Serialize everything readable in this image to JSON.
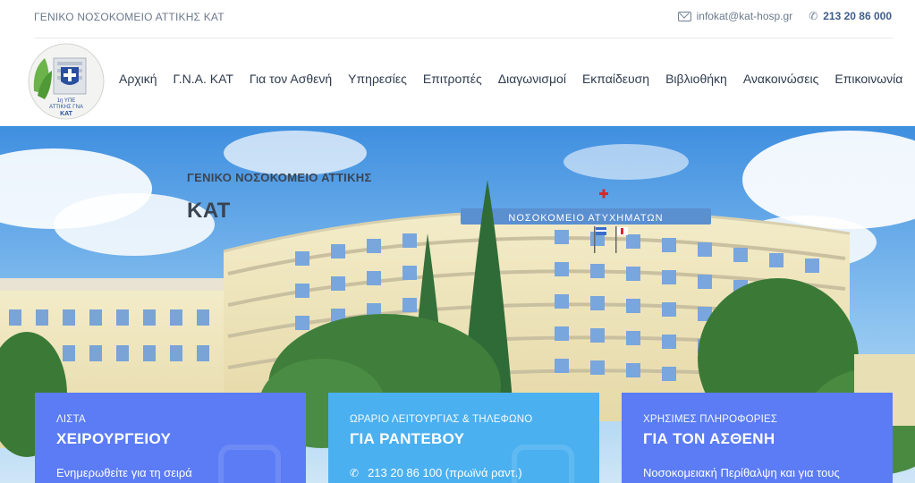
{
  "topbar": {
    "hospital_name": "ΓΕΝΙΚΟ ΝΟΣΟΚΟΜΕΙΟ ΑΤΤΙΚΗΣ ΚΑΤ",
    "email": "infokat@kat-hosp.gr",
    "phone": "213 20 86 000"
  },
  "logo": {
    "text_line1": "1η ΥΠΕ",
    "text_line2": "ΑΤΤΙΚΗΣ ΓΝΑ",
    "text_line3": "ΚΑΤ"
  },
  "nav": {
    "items": [
      "Αρχική",
      "Γ.Ν.Α. ΚΑΤ",
      "Για τον Ασθενή",
      "Υπηρεσίες",
      "Επιτροπές",
      "Διαγωνισμοί",
      "Εκπαίδευση",
      "Βιβλιοθήκη",
      "Ανακοινώσεις",
      "Επικοινωνία"
    ]
  },
  "hero": {
    "subtitle": "ΓΕΝΙΚΟ ΝΟΣΟΚΟΜΕΙΟ ΑΤΤΙΚΗΣ",
    "title": "ΚΑΤ",
    "building_sign": "ΝΟΣΟΚΟΜΕΙΟ ΑΤΥΧΗΜΑΤΩΝ"
  },
  "cards": [
    {
      "small": "ΛΙΣΤΑ",
      "big": "ΧΕΙΡΟΥΡΓΕΙΟΥ",
      "body": "Ενημερωθείτε για τη σειρά"
    },
    {
      "small": "ΩΡΑΡΙΟ ΛΕΙΤΟΥΡΓΙΑΣ & ΤΗΛΕΦΩΝΟ",
      "big": "ΓΙΑ ΡΑΝΤΕΒΟΥ",
      "body": "213 20 86 100 (πρωϊνά ραντ.)"
    },
    {
      "small": "ΧΡΗΣΙΜΕΣ ΠΛΗΡΟΦΟΡΙΕΣ",
      "big": "ΓΙΑ ΤΟΝ ΑΣΘΕΝΗ",
      "body": "Νοσοκομειακή Περίθαλψη και για τους"
    }
  ],
  "colors": {
    "card_blue": "#5b7cf4",
    "card_light_blue": "#4bb0f0",
    "nav_text": "#2e3b4e",
    "topbar_text": "#6b7a8c"
  },
  "icons": {
    "email": "mail-icon",
    "phone": "phone-icon",
    "card_phone": "phone-icon"
  }
}
